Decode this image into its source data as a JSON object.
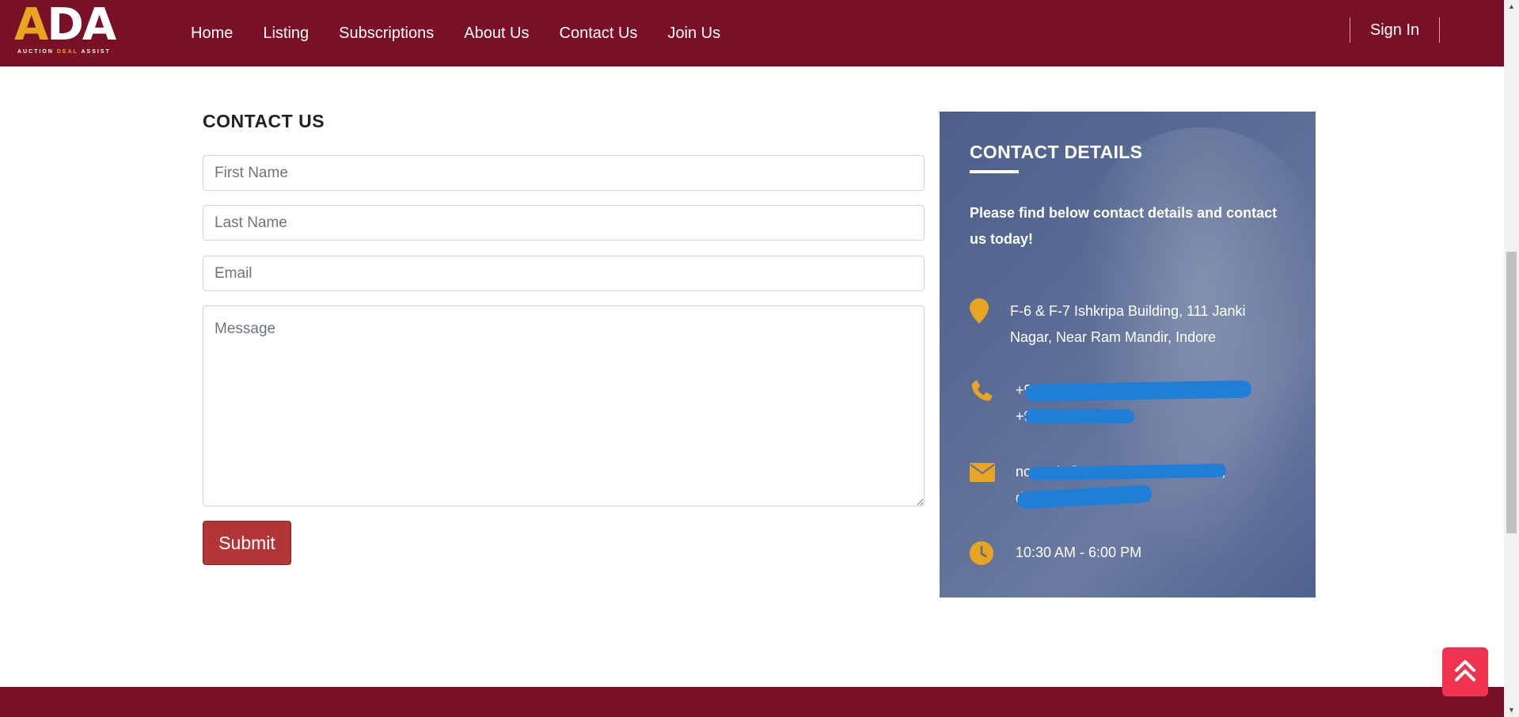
{
  "header": {
    "logo_text": "ADA",
    "logo_sub_left": "AUCTION",
    "logo_sub_mid": "DEAL",
    "logo_sub_right": "ASSIST",
    "nav": [
      "Home",
      "Listing",
      "Subscriptions",
      "About Us",
      "Contact Us",
      "Join Us"
    ],
    "signin": "Sign In"
  },
  "form": {
    "title": "CONTACT US",
    "first_name_placeholder": "First Name",
    "last_name_placeholder": "Last Name",
    "email_placeholder": "Email",
    "message_placeholder": "Message",
    "submit_label": "Submit"
  },
  "details": {
    "title": "CONTACT DETAILS",
    "intro": "Please find below contact details and contact us today!",
    "address_line1": "F-6 & F-7 Ishkripa Building, 111 Janki",
    "address_line2": "Nagar, Near Ram Mandir, Indore",
    "phone_line1": "+9",
    "phone_line2": "+9",
    "email_line1": "no-reply@auctiondealassist.com,",
    "email_line2": "dealassist.com",
    "hours": "10:30 AM - 6:00 PM"
  },
  "icons": {
    "location": "location-pin-icon",
    "phone": "phone-icon",
    "email": "envelope-icon",
    "clock": "clock-icon",
    "back_to_top": "double-chevron-up-icon"
  },
  "colors": {
    "brand": "#7a1025",
    "accent": "#e8a521",
    "submit": "#b23538",
    "back_to_top": "#f0344f",
    "redaction": "#1f7fd6"
  }
}
